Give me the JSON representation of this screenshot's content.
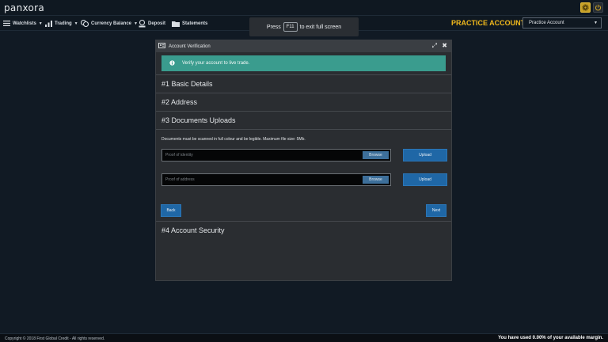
{
  "app": {
    "logo": "panxora"
  },
  "menu": {
    "watchlists": "Watchlists",
    "trading": "Trading",
    "currency_balance": "Currency Balance",
    "deposit": "Deposit",
    "statements": "Statements"
  },
  "account": {
    "mode_label": "PRACTICE ACCOUNT",
    "selected": "Practice Account"
  },
  "toast": {
    "before": "Press",
    "key": "F11",
    "after": "to exit full screen"
  },
  "modal": {
    "title": "Account Verification",
    "alert": "Verify your account to live trade.",
    "sections": [
      "#1 Basic Details",
      "#2 Address",
      "#3 Documents Uploads",
      "#4 Account Security"
    ],
    "docs": {
      "hint": "Documents must be scanned in full colour and be legible. Maximum file size: 5Mb.",
      "identity_placeholder": "Proof of identity",
      "address_placeholder": "Proof of address",
      "browse_label": "Browse",
      "upload_label": "Upload",
      "back_label": "Back",
      "next_label": "Next"
    }
  },
  "footer": {
    "copyright": "Copyright © 2018 First Global Credit - All rights reserved.",
    "margin": "You have used 0.00% of your available margin."
  },
  "colors": {
    "accent": "#f0b81c",
    "alert": "#3a9c8e",
    "primary_button": "#1f67a6",
    "background": "#111a24"
  }
}
